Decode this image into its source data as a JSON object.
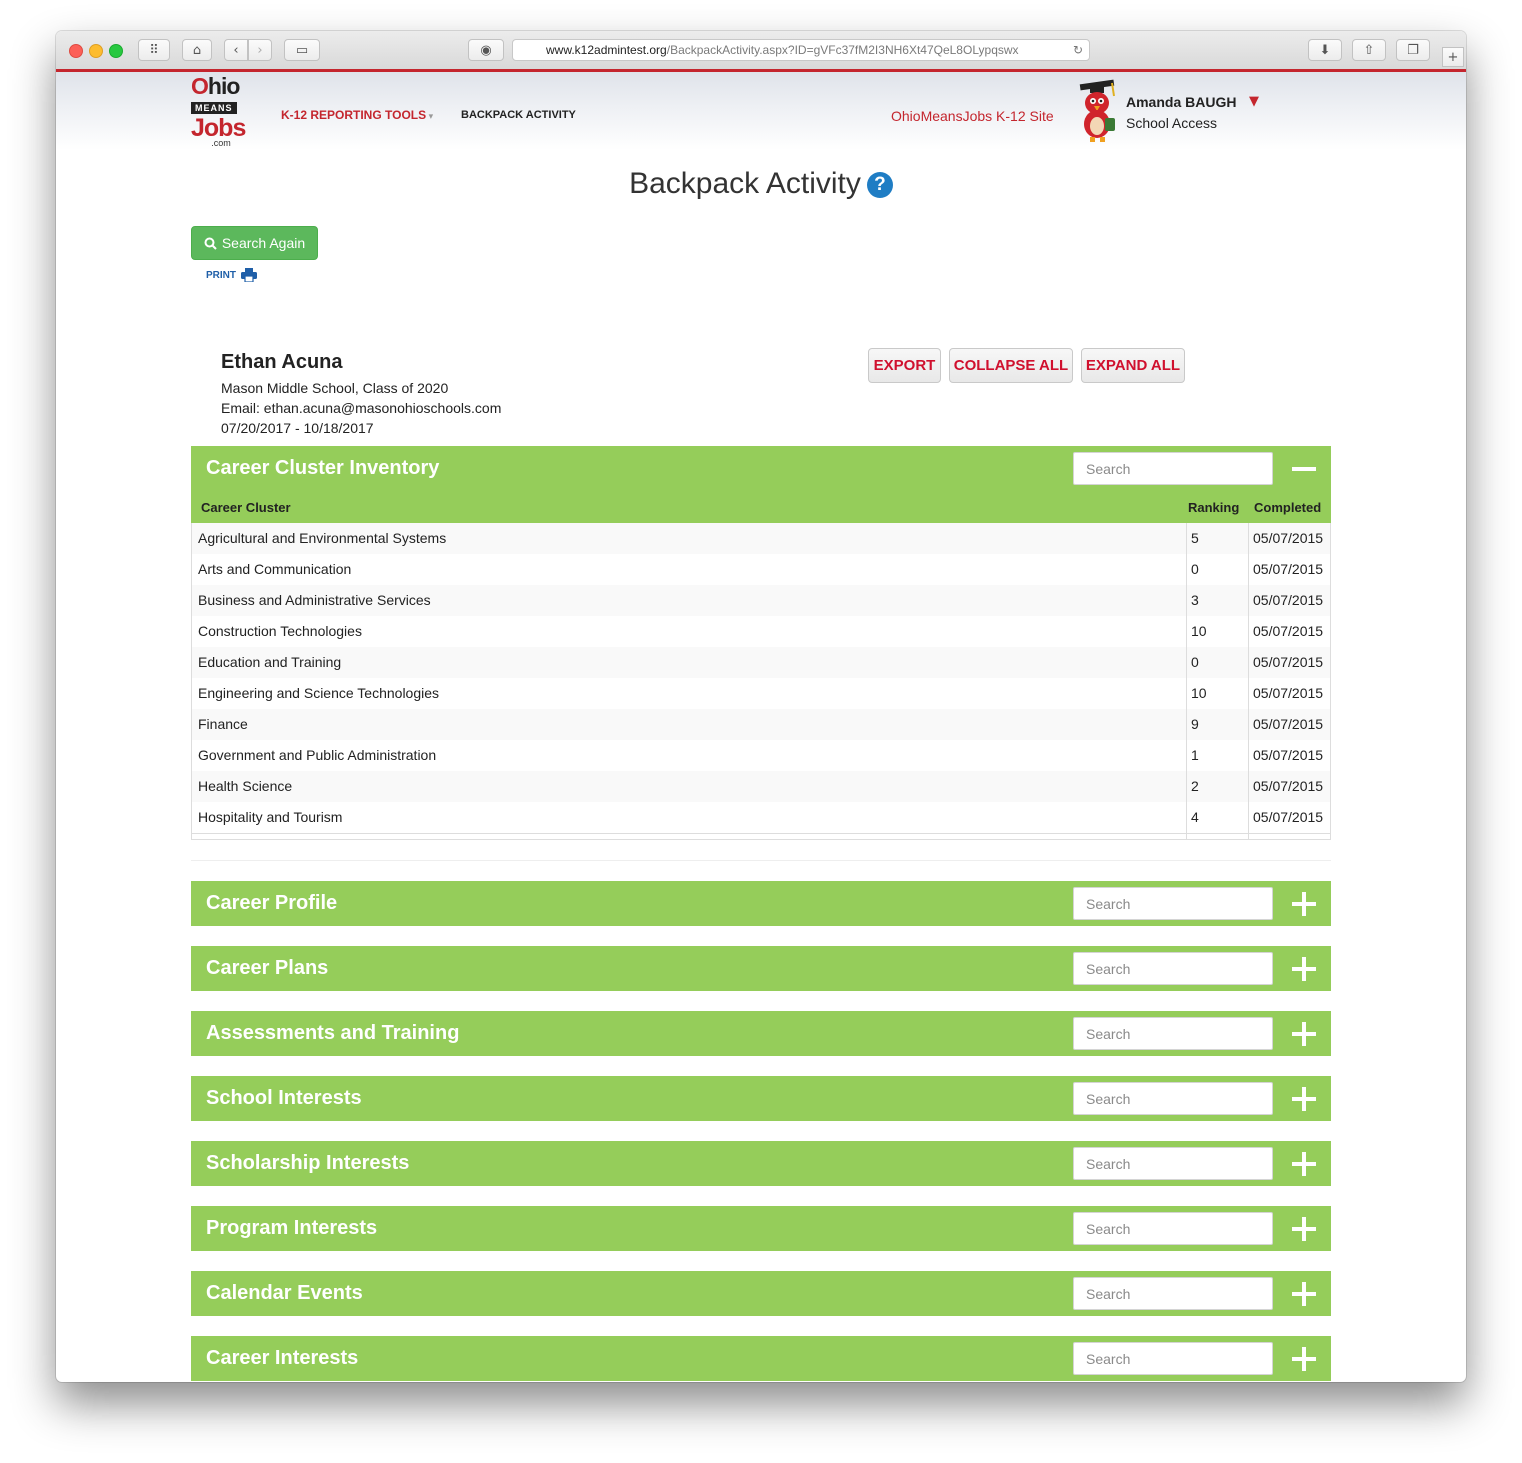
{
  "browser": {
    "url_main": "www.k12admintest.org",
    "url_path": "/BackpackActivity.aspx?ID=gVFc37fM2I3NH6Xt47QeL8OLypqswx"
  },
  "header": {
    "logo": {
      "ohio": "Ohio",
      "means": "MEANS",
      "jobs": "Jobs",
      "com": ".com"
    },
    "nav_tools": "K-12 REPORTING TOOLS",
    "nav_backpack": "BACKPACK ACTIVITY",
    "k12_site_link": "OhioMeansJobs K-12 Site",
    "user_name": "Amanda BAUGH",
    "user_role": "School Access"
  },
  "page": {
    "title": "Backpack Activity",
    "search_again": "Search Again",
    "print": "PRINT"
  },
  "student": {
    "name": "Ethan Acuna",
    "school": "Mason Middle School, Class of 2020",
    "email": "Email: ethan.acuna@masonohioschools.com",
    "date_range": "07/20/2017 - 10/18/2017"
  },
  "actions": {
    "export": "EXPORT",
    "collapse_all": "COLLAPSE ALL",
    "expand_all": "EXPAND ALL"
  },
  "search_placeholder": "Search",
  "career_cluster": {
    "title": "Career Cluster Inventory",
    "columns": {
      "cluster": "Career Cluster",
      "ranking": "Ranking",
      "completed": "Completed"
    },
    "rows": [
      {
        "cluster": "Agricultural and Environmental Systems",
        "ranking": "5",
        "completed": "05/07/2015"
      },
      {
        "cluster": "Arts and Communication",
        "ranking": "0",
        "completed": "05/07/2015"
      },
      {
        "cluster": "Business and Administrative Services",
        "ranking": "3",
        "completed": "05/07/2015"
      },
      {
        "cluster": "Construction Technologies",
        "ranking": "10",
        "completed": "05/07/2015"
      },
      {
        "cluster": "Education and Training",
        "ranking": "0",
        "completed": "05/07/2015"
      },
      {
        "cluster": "Engineering and Science Technologies",
        "ranking": "10",
        "completed": "05/07/2015"
      },
      {
        "cluster": "Finance",
        "ranking": "9",
        "completed": "05/07/2015"
      },
      {
        "cluster": "Government and Public Administration",
        "ranking": "1",
        "completed": "05/07/2015"
      },
      {
        "cluster": "Health Science",
        "ranking": "2",
        "completed": "05/07/2015"
      },
      {
        "cluster": "Hospitality and Tourism",
        "ranking": "4",
        "completed": "05/07/2015"
      }
    ]
  },
  "sections": [
    {
      "title": "Career Profile"
    },
    {
      "title": "Career Plans"
    },
    {
      "title": "Assessments and Training"
    },
    {
      "title": "School Interests"
    },
    {
      "title": "Scholarship Interests"
    },
    {
      "title": "Program Interests"
    },
    {
      "title": "Calendar Events"
    },
    {
      "title": "Career Interests"
    }
  ],
  "colors": {
    "brand_red": "#c4262e",
    "section_green": "#95cd5a",
    "button_green": "#5cb85c",
    "action_red": "#d0102e",
    "help_blue": "#1f7dc4"
  }
}
